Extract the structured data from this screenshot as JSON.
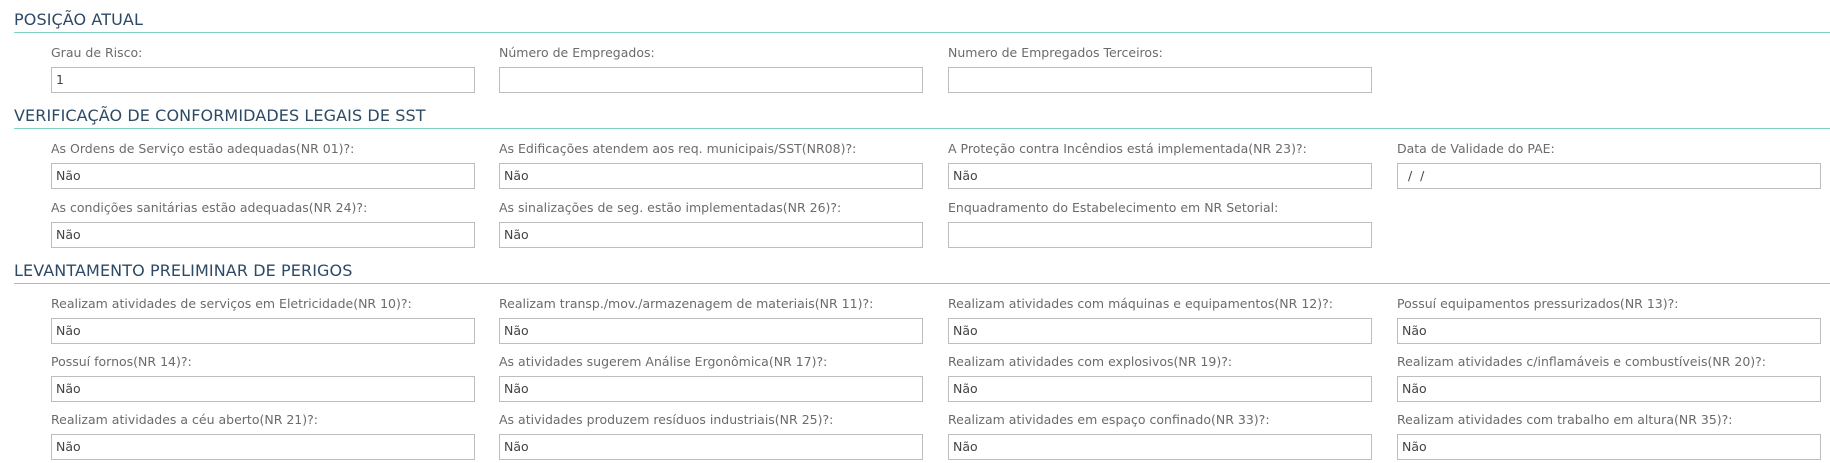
{
  "sections": {
    "posicao": {
      "title": "POSIÇÃO ATUAL",
      "fields": [
        {
          "label": "Grau de Risco:",
          "value": "1"
        },
        {
          "label": "Número de Empregados:",
          "value": ""
        },
        {
          "label": "Numero de Empregados Terceiros:",
          "value": ""
        }
      ]
    },
    "conformidades": {
      "title": "VERIFICAÇÃO DE CONFORMIDADES LEGAIS DE SST",
      "fields": [
        {
          "label": "As Ordens de Serviço estão adequadas(NR 01)?:",
          "value": "Não"
        },
        {
          "label": "As Edificações atendem aos req. municipais/SST(NR08)?:",
          "value": "Não"
        },
        {
          "label": "A Proteção contra Incêndios está implementada(NR 23)?:",
          "value": "Não"
        },
        {
          "label": "Data de Validade do PAE:",
          "value": "/ /"
        },
        {
          "label": "As condições sanitárias estão adequadas(NR 24)?:",
          "value": "Não"
        },
        {
          "label": "As sinalizações de seg. estão implementadas(NR 26)?:",
          "value": "Não"
        },
        {
          "label": "Enquadramento do Estabelecimento em NR Setorial:",
          "value": ""
        }
      ]
    },
    "perigos": {
      "title": "LEVANTAMENTO PRELIMINAR DE PERIGOS",
      "fields": [
        {
          "label": "Realizam atividades de serviços em Eletricidade(NR 10)?:",
          "value": "Não"
        },
        {
          "label": "Realizam transp./mov./armazenagem de materiais(NR 11)?:",
          "value": "Não"
        },
        {
          "label": "Realizam atividades com máquinas e equipamentos(NR 12)?:",
          "value": "Não"
        },
        {
          "label": "Possuí equipamentos pressurizados(NR 13)?:",
          "value": "Não"
        },
        {
          "label": "Possuí fornos(NR 14)?:",
          "value": "Não"
        },
        {
          "label": "As atividades sugerem Análise Ergonômica(NR 17)?:",
          "value": "Não"
        },
        {
          "label": "Realizam atividades com explosivos(NR 19)?:",
          "value": "Não"
        },
        {
          "label": "Realizam atividades c/inflamáveis e combustíveis(NR 20)?:",
          "value": "Não"
        },
        {
          "label": "Realizam atividades a céu aberto(NR 21)?:",
          "value": "Não"
        },
        {
          "label": "As atividades produzem resíduos industriais(NR 25)?:",
          "value": "Não"
        },
        {
          "label": "Realizam atividades em espaço confinado(NR 33)?:",
          "value": "Não"
        },
        {
          "label": "Realizam atividades com trabalho em altura(NR 35)?:",
          "value": "Não"
        }
      ]
    }
  }
}
